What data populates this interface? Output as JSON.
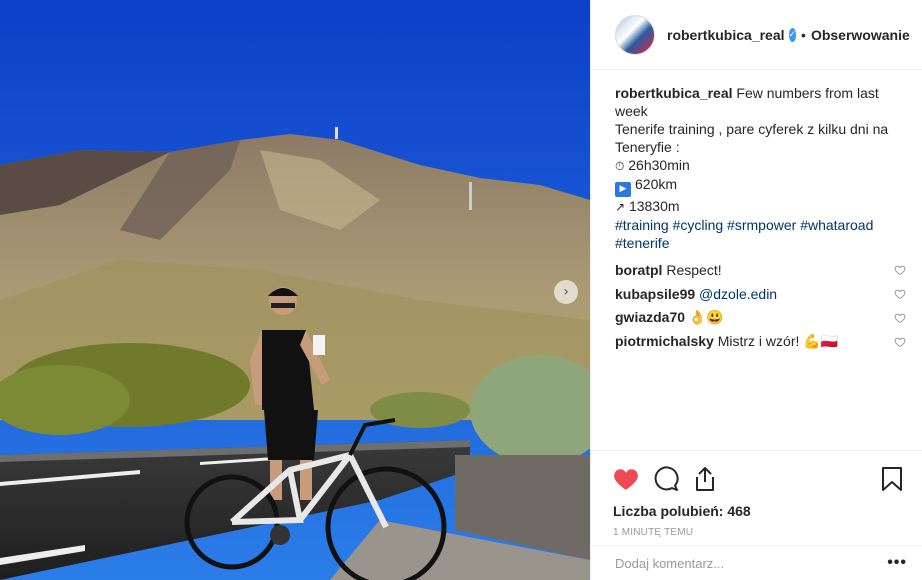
{
  "post": {
    "photo_alt": "",
    "next_icon": "chevron-right-icon"
  },
  "header": {
    "username": "robertkubica_real",
    "verified_icon": "verified-badge-icon",
    "separator": "•",
    "follow_label": "Obserwowanie"
  },
  "caption": {
    "username": "robertkubica_real",
    "line1": "Few numbers from last week",
    "line2": "Tenerife training , pare cyferek z kilku dni na",
    "line3": "Teneryfie :",
    "stat_time_glyph": "⏱",
    "stat_time": "26h30min",
    "stat_distance_glyph": "▶",
    "stat_distance": "620km",
    "stat_elevation_glyph": "↗",
    "stat_elevation": "13830m",
    "hashtags_line1": "#training #cycling #srmpower #whataroad",
    "hashtags_line2": "#tenerife"
  },
  "comments": [
    {
      "user": "boratpl",
      "text": "Respect!"
    },
    {
      "user": "kubapsile99",
      "text": "@dzole.edin"
    },
    {
      "user": "gwiazda70",
      "text": "👌😃"
    },
    {
      "user": "piotrmichalsky",
      "text": "Mistrz i wzór! 💪🇵🇱"
    }
  ],
  "actions": {
    "liked": true,
    "like_color": "#ed4956",
    "likes_label": "Liczba polubień: 468",
    "timestamp": "1 MINUTĘ TEMU"
  },
  "add_comment": {
    "placeholder": "Dodaj komentarz...",
    "more_label": "•••"
  },
  "colors": {
    "sky": "#1c58d9",
    "hashtag": "#003569",
    "verified": "#3897f0"
  }
}
